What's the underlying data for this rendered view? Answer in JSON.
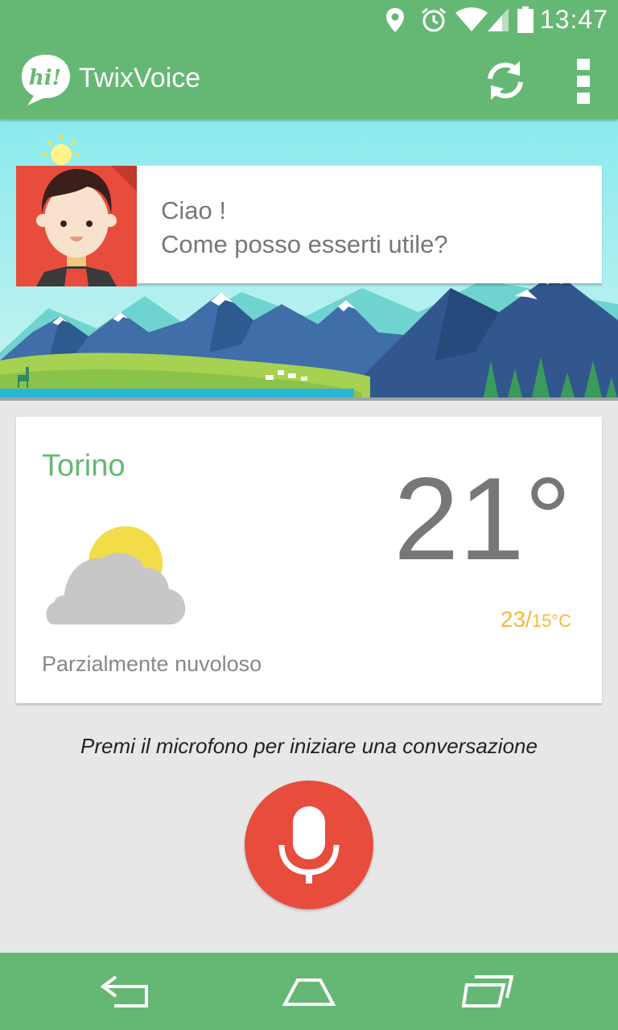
{
  "status_bar": {
    "time": "13:47",
    "icons": [
      "location-icon",
      "alarm-icon",
      "wifi-icon",
      "signal-icon",
      "battery-icon"
    ]
  },
  "app_bar": {
    "logo_text": "hi!",
    "title": "TwixVoice",
    "actions": [
      "refresh-icon",
      "more-vert-icon"
    ]
  },
  "greeting": {
    "line1": "Ciao  !",
    "line2": "Come posso esserti utile?"
  },
  "weather": {
    "city": "Torino",
    "temperature": "21°",
    "range_high": "23/",
    "range_low": "15°C",
    "condition": "Parzialmente nuvoloso",
    "icon": "partly-cloudy-icon"
  },
  "hint": "Premi il microfono per iniziare una conversazione",
  "navigation": [
    "back-icon",
    "home-icon",
    "recents-icon"
  ],
  "colors": {
    "primary": "#65b873",
    "accent_red": "#e84c3d",
    "temp_range": "#f6b93b",
    "background": "#e6e7e6"
  }
}
